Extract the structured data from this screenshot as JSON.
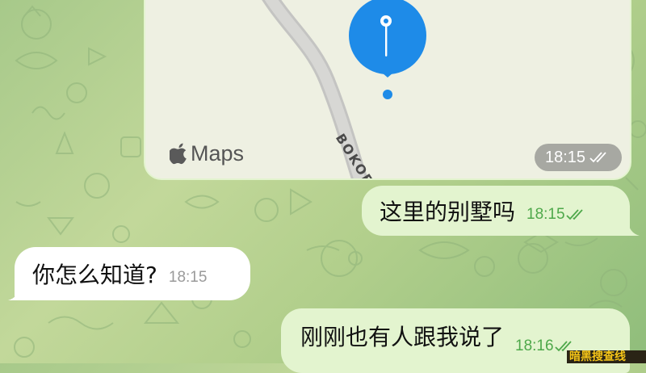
{
  "map": {
    "street_label": "BOKOF",
    "brand": "Maps",
    "time": "18:15",
    "pin_color": "#1e8be8"
  },
  "messages": [
    {
      "direction": "outgoing",
      "text": "这里的别墅吗",
      "time": "18:15",
      "status": "read"
    },
    {
      "direction": "incoming",
      "text": "你怎么知道?",
      "time": "18:15"
    },
    {
      "direction": "outgoing",
      "text": "刚刚也有人跟我说了",
      "time": "18:16",
      "status": "read"
    }
  ],
  "watermark": {
    "text": "暗黑搜查线"
  },
  "colors": {
    "outgoing_bubble": "#e3f4cf",
    "incoming_bubble": "#ffffff",
    "read_ticks": "#4ea84a",
    "wallpaper": "#b2cf8c"
  }
}
